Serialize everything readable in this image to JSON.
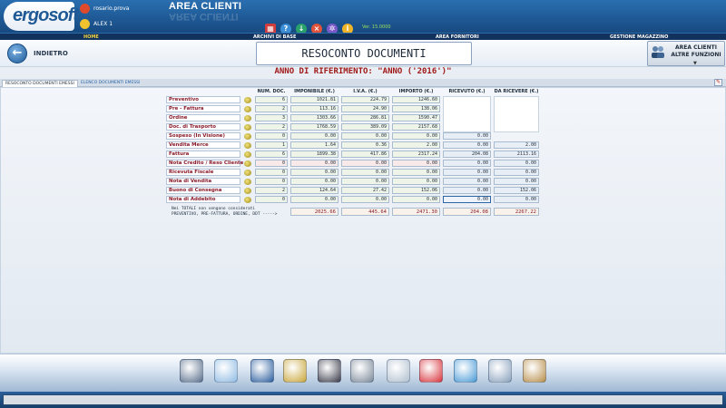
{
  "app": {
    "logo_text": "ergosoft",
    "user_name": "rosario.prova",
    "client_name": "ALEX 1",
    "area_title": "AREA CLIENTI",
    "version": "Ver. 15.0000",
    "header_icons": [
      "calendar-icon",
      "help-icon",
      "download-icon",
      "close-circle-icon",
      "settings-icon",
      "info-icon"
    ]
  },
  "nav": {
    "home": "HOME",
    "archivi": "ARCHIVI DI BASE",
    "fornitori": "AREA FORNITORI",
    "magazzino": "GESTIONE MAGAZZINO"
  },
  "page": {
    "back_label": "INDIETRO",
    "title": "RESOCONTO DOCUMENTI",
    "subtitle": "ANNO DI RIFERIMENTO: \"ANNO ('2016')\"",
    "right_button": {
      "line1": "AREA CLIENTI",
      "line2": "ALTRE FUNZIONI",
      "arrow": "▼"
    }
  },
  "tabs": [
    {
      "label": "RESOCONTO DOCUMENTI EMESSI",
      "active": true
    },
    {
      "label": "ELENCO DOCUMENTI EMESSI",
      "active": false
    }
  ],
  "table": {
    "headers": [
      "NUM. DOC.",
      "IMPONIBILE (€.)",
      "I.V.A. (€.)",
      "IMPORTO (€.)",
      "RICEVUTO (€.)",
      "DA RICEVERE (€.)"
    ],
    "rows": [
      {
        "label": "Preventivo",
        "num": "6",
        "imponibile": "1021.81",
        "iva": "224.79",
        "importo": "1246.60",
        "ricevuto": "",
        "da_ricevere": ""
      },
      {
        "label": "Pre - Fattura",
        "num": "2",
        "imponibile": "113.16",
        "iva": "24.90",
        "importo": "138.06",
        "ricevuto": "",
        "da_ricevere": ""
      },
      {
        "label": "Ordine",
        "num": "3",
        "imponibile": "1303.66",
        "iva": "286.81",
        "importo": "1590.47",
        "ricevuto": "",
        "da_ricevere": ""
      },
      {
        "label": "Doc. di Trasporto",
        "num": "2",
        "imponibile": "1768.59",
        "iva": "389.09",
        "importo": "2157.68",
        "ricevuto": "",
        "da_ricevere": ""
      },
      {
        "label": "Sospeso (In Visione)",
        "num": "0",
        "imponibile": "0.00",
        "iva": "0.00",
        "importo": "0.00",
        "ricevuto": "0.00",
        "da_ricevere": ""
      },
      {
        "label": "Vendita Merce",
        "num": "1",
        "imponibile": "1.64",
        "iva": "0.36",
        "importo": "2.00",
        "ricevuto": "0.00",
        "da_ricevere": "2.00"
      },
      {
        "label": "Fattura",
        "num": "6",
        "imponibile": "1899.38",
        "iva": "417.86",
        "importo": "2317.24",
        "ricevuto": "204.08",
        "da_ricevere": "2113.16"
      },
      {
        "label": "Nota Credito / Reso Cliente",
        "num": "0",
        "imponibile": "0.00",
        "iva": "0.00",
        "importo": "0.00",
        "ricevuto": "0.00",
        "da_ricevere": "0.00"
      },
      {
        "label": "Ricevuta Fiscale",
        "num": "0",
        "imponibile": "0.00",
        "iva": "0.00",
        "importo": "0.00",
        "ricevuto": "0.00",
        "da_ricevere": "0.00"
      },
      {
        "label": "Nota di Vendita",
        "num": "0",
        "imponibile": "0.00",
        "iva": "0.00",
        "importo": "0.00",
        "ricevuto": "0.00",
        "da_ricevere": "0.00"
      },
      {
        "label": "Buono di Consegna",
        "num": "2",
        "imponibile": "124.64",
        "iva": "27.42",
        "importo": "152.06",
        "ricevuto": "0.00",
        "da_ricevere": "152.06"
      },
      {
        "label": "Nota di Addebito",
        "num": "0",
        "imponibile": "0.00",
        "iva": "0.00",
        "importo": "0.00",
        "ricevuto": "0.00",
        "da_ricevere": "0.00"
      }
    ],
    "totals_note_1": "Nei TOTALI non vengono considerati",
    "totals_note_2": "PREVENTIVO, PRE-FATTURA, ORDINE, DDT ----->",
    "totals": {
      "imponibile": "2025.66",
      "iva": "445.64",
      "importo": "2471.30",
      "ricevuto": "204.08",
      "da_ricevere": "2267.22"
    }
  },
  "dock_icons": [
    "customer-icon",
    "card-icon",
    "binder-icon",
    "documents-icon",
    "security-guard-icon",
    "database-icon",
    "printer-icon",
    "calendar-clock-icon",
    "tag-icon",
    "magnifier-icon",
    "tools-icon"
  ]
}
